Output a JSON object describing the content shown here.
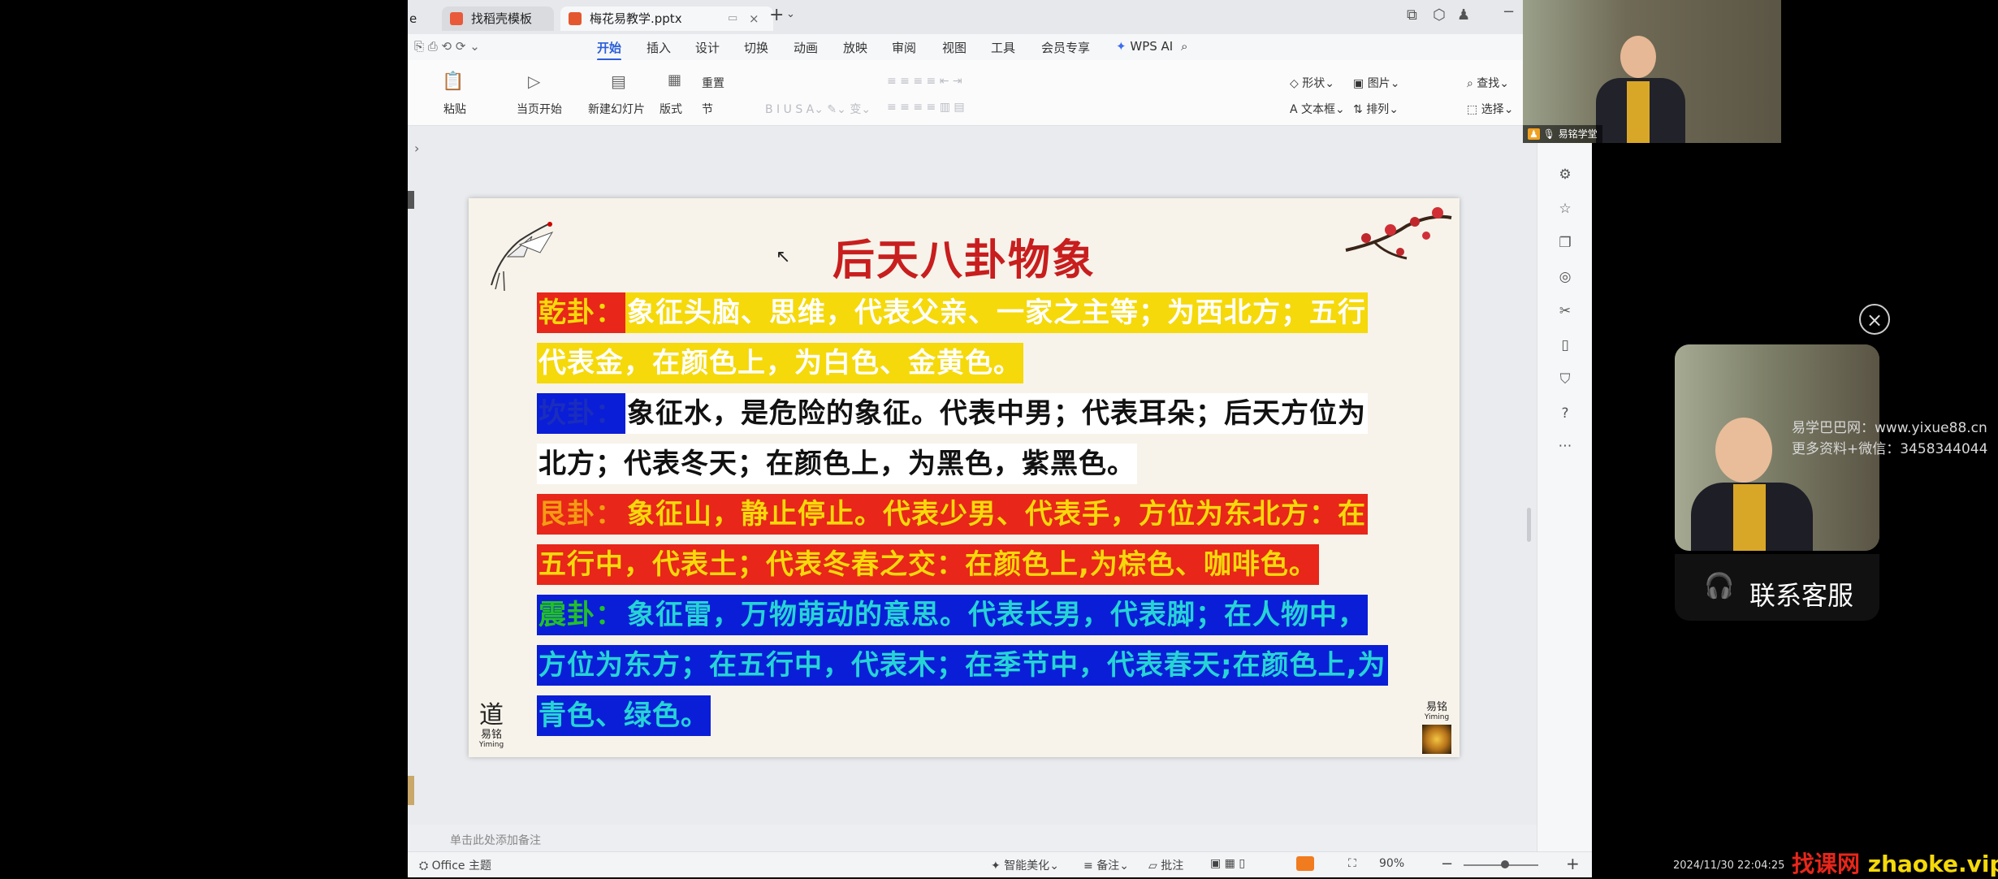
{
  "window": {
    "tabs": [
      {
        "label": "e"
      },
      {
        "label": "找稻壳模板"
      },
      {
        "label": "梅花易教学.pptx"
      }
    ],
    "menu": [
      "开始",
      "插入",
      "设计",
      "切换",
      "动画",
      "放映",
      "审阅",
      "视图",
      "工具",
      "会员专享",
      "WPS AI"
    ],
    "active_menu": "开始"
  },
  "ribbon": {
    "paste": "粘贴",
    "play_from_current": "当页开始",
    "new_slide": "新建幻灯片",
    "layout": "版式",
    "section": "节",
    "reset": "重置",
    "shape": "形状",
    "image": "图片",
    "find": "查找",
    "textbox": "文本框",
    "arrange": "排列",
    "select": "选择"
  },
  "slide": {
    "title": "后天八卦物象",
    "logo_left": {
      "big": "道",
      "small1": "易铭",
      "small2": "Yiming"
    },
    "logo_right": {
      "small1": "易铭",
      "small2": "Yiming"
    },
    "lines": [
      {
        "label": "乾卦：",
        "text": "象征头脑、思维，代表父亲、一家之主等；为西北方；五行"
      },
      {
        "text": "代表金，在颜色上，为白色、金黄色。"
      },
      {
        "label": "坎卦：",
        "text": "象征水，是危险的象征。代表中男；代表耳朵；后天方位为"
      },
      {
        "text": "北方；代表冬天；在颜色上，为黑色，紫黑色。"
      },
      {
        "label": "艮卦：",
        "text": "象征山，静止停止。代表少男、代表手，方位为东北方：在"
      },
      {
        "text": "五行中，代表土；代表冬春之交：在颜色上,为棕色、咖啡色。"
      },
      {
        "label": "震卦：",
        "text": "象征雷，万物萌动的意思。代表长男，代表脚；在人物中，"
      },
      {
        "text": "方位为东方；在五行中，代表木；在季节中，代表春天;在颜色上,为"
      },
      {
        "text": "青色、绿色。"
      }
    ]
  },
  "notes_placeholder": "单击此处添加备注",
  "status": {
    "theme": "Office 主题",
    "beautify": "智能美化",
    "notes": "备注",
    "comments": "批注",
    "zoom": "90%"
  },
  "video": {
    "presenter_label": "易铭学堂",
    "contact_label": "联系客服"
  },
  "watermark": {
    "line1": "易学巴巴网：www.yixue88.cn",
    "line2": "更多资料+微信：3458344044",
    "timestamp": "2024/11/30 22:04:25",
    "site_cn": "找课网",
    "site_en": "zhaoke.vip"
  },
  "colors": {
    "yellow": "#f5d90a",
    "red_hl": "#e8261a",
    "blue_hl": "#0a1ed8",
    "orange_label": "#f39c12",
    "green_label": "#22c02a",
    "cyan_text": "#26d4d4",
    "title_red": "#c81e1e"
  }
}
